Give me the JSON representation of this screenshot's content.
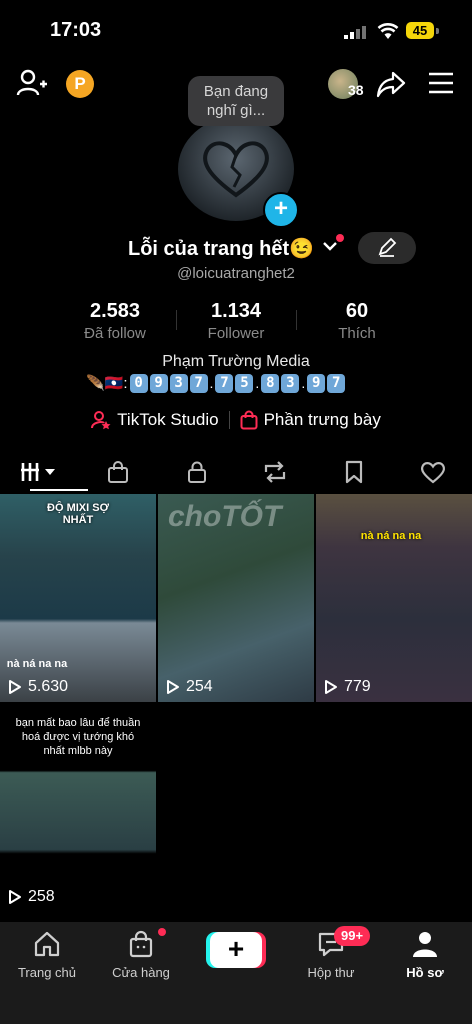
{
  "status_bar": {
    "time": "17:03",
    "battery": "45"
  },
  "header": {
    "coin_label": "P",
    "friend_count": "38"
  },
  "profile": {
    "thought_bubble": "Bạn đang nghĩ gì...",
    "add_badge": "+",
    "display_name": "Lỗi của trang hết😉",
    "handle": "@loicuatranghet2",
    "stats": [
      {
        "value": "2.583",
        "label": "Đã follow"
      },
      {
        "value": "1.134",
        "label": "Follower"
      },
      {
        "value": "60",
        "label": "Thích"
      }
    ],
    "bio_line1": "Phạm Trường Media",
    "bio_prefix": "🪶🇱🇦:",
    "phone_digits": [
      "0",
      "9",
      "3",
      "7",
      "7",
      "5",
      "8",
      "3",
      "9",
      "7"
    ],
    "links": {
      "studio": "TikTok Studio",
      "showcase": "Phần trưng bày"
    }
  },
  "videos": [
    {
      "views": "5.630",
      "caption_top": "ĐỘ MIXI SỢ NHẤT",
      "caption_mid": "nà ná na na"
    },
    {
      "views": "254",
      "caption_top": "",
      "caption_mid": ""
    },
    {
      "views": "779",
      "caption_top": "",
      "caption_mid": "nà ná na na"
    },
    {
      "views": "258",
      "caption_top": "bạn mất bao lâu để thuần hoá được vị tướng khó nhất mlbb này",
      "caption_mid": ""
    }
  ],
  "watermark": "choTỐT",
  "bottom_nav": [
    {
      "label": "Trang chủ",
      "icon": "home-icon"
    },
    {
      "label": "Cửa hàng",
      "icon": "shop-icon"
    },
    {
      "label": "+",
      "icon": "create-icon"
    },
    {
      "label": "Hộp thư",
      "icon": "inbox-icon",
      "badge": "99+"
    },
    {
      "label": "Hồ sơ",
      "icon": "profile-icon"
    }
  ],
  "colors": {
    "accent": "#fe2c55",
    "cyan": "#25f4ee",
    "blue": "#1fb5e8"
  }
}
